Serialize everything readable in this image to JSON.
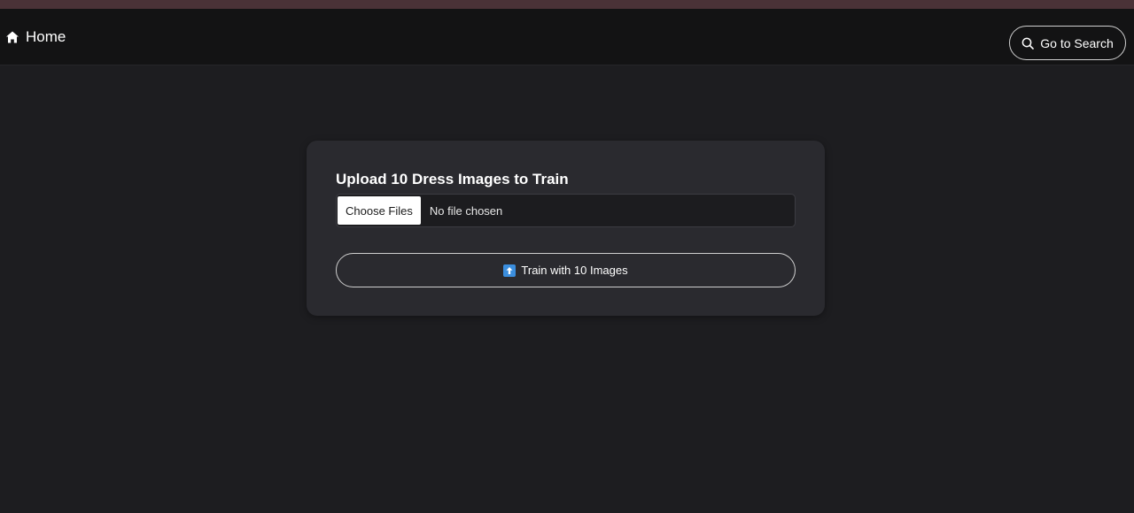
{
  "navbar": {
    "home_label": "Home",
    "search_button_label": "Go to Search",
    "home_icon": "home-icon",
    "search_icon": "search-icon"
  },
  "upload_card": {
    "title": "Upload 10 Dress Images to Train",
    "file_input": {
      "button_label": "Choose Files",
      "status_text": "No file chosen"
    },
    "train_button_label": "Train with 10 Images",
    "train_button_icon": "up-arrow-icon"
  },
  "colors": {
    "top_strip": "#4a3237",
    "navbar_bg": "#131314",
    "page_bg": "#1d1d20",
    "card_bg": "#2a2a2f",
    "accent_icon": "#3b8ede"
  }
}
